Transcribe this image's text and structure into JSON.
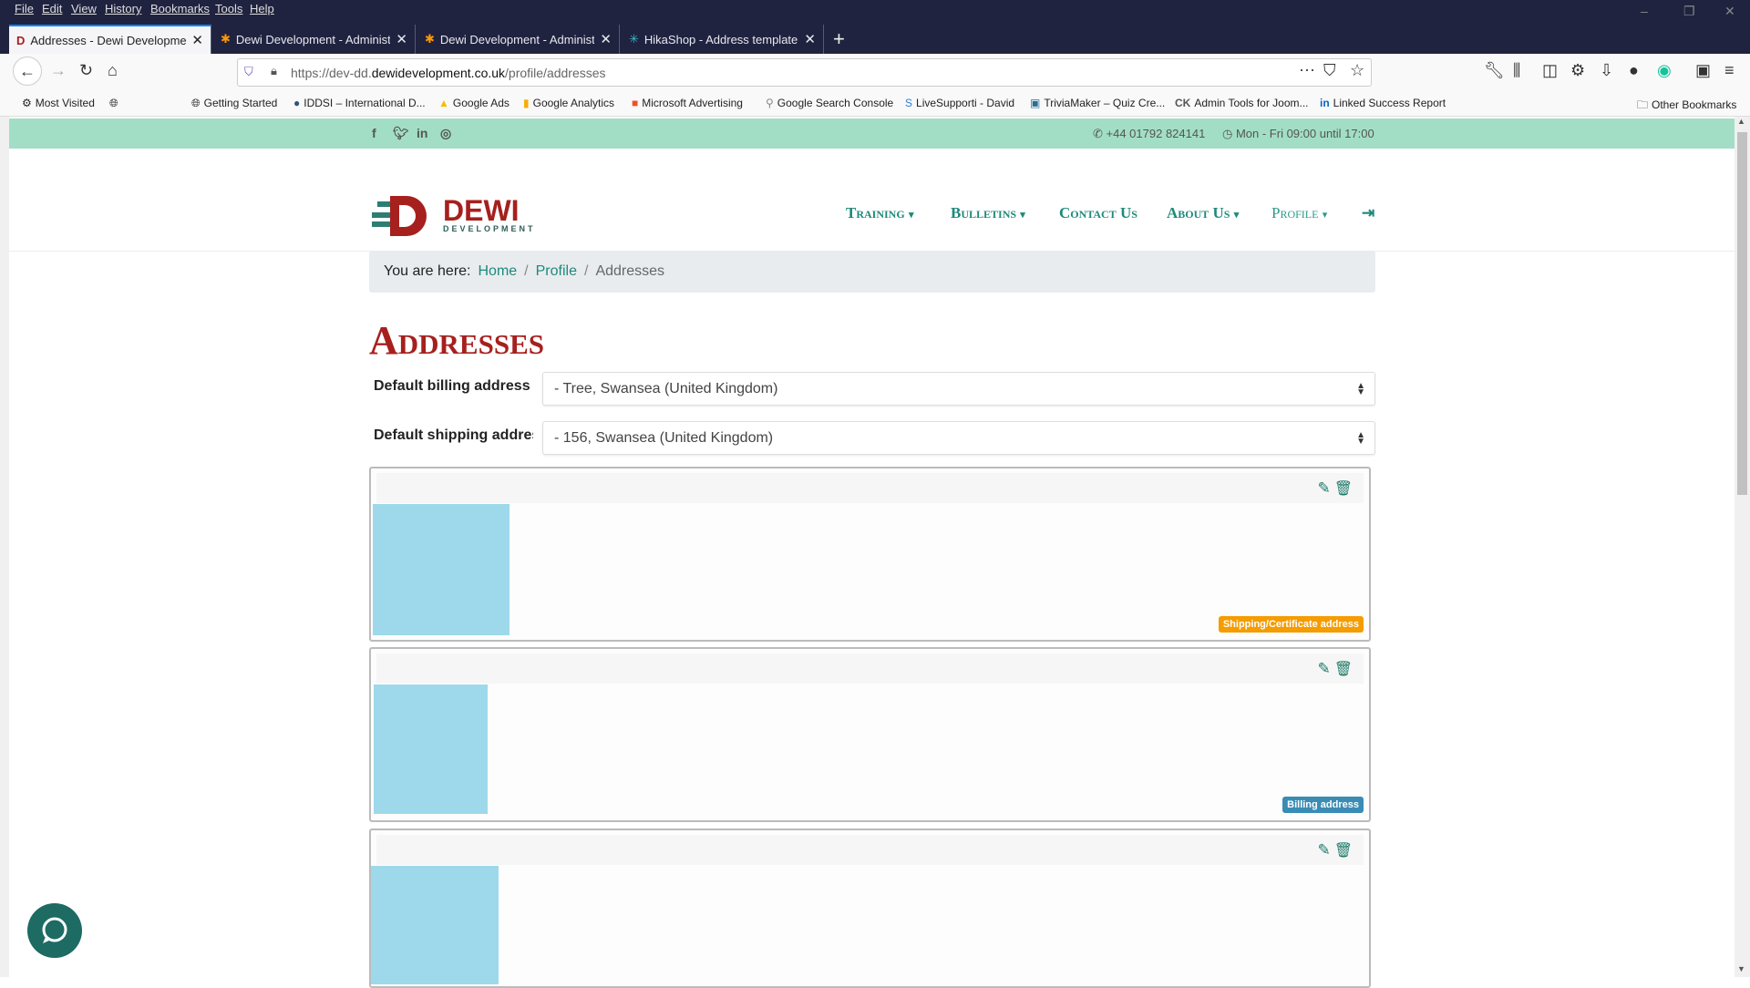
{
  "browser": {
    "menu": [
      "File",
      "Edit",
      "View",
      "History",
      "Bookmarks",
      "Tools",
      "Help"
    ],
    "tabs": [
      {
        "label": "Addresses - Dewi Development"
      },
      {
        "label": "Dewi Development - Administr"
      },
      {
        "label": "Dewi Development - Administr"
      },
      {
        "label": "HikaShop - Address template S"
      }
    ],
    "url_prefix": "https://dev-dd.",
    "url_domain": "dewidevelopment.co.uk",
    "url_path": "/profile/addresses",
    "bookmarks": [
      "Most Visited",
      "Getting Started",
      "IDDSI – International D...",
      "Google Ads",
      "Google Analytics",
      "Microsoft Advertising",
      "Google Search Console",
      "LiveSupporti - David",
      "TriviaMaker – Quiz Cre...",
      "Admin Tools for Joom...",
      "Linked Success Report"
    ],
    "other_bookmarks": "Other Bookmarks"
  },
  "topbar": {
    "phone": "+44 01792 824141",
    "hours": "Mon - Fri 09:00 until 17:00"
  },
  "logo": {
    "name": "DEWI",
    "sub": "DEVELOPMENT"
  },
  "nav": [
    "Training",
    "Bulletins",
    "Contact Us",
    "About Us",
    "Profile"
  ],
  "breadcrumb": {
    "prefix": "You are here:",
    "items": [
      "Home",
      "Profile"
    ],
    "current": "Addresses"
  },
  "page": {
    "title": "Addresses",
    "billing_label": "Default billing address",
    "billing_value": "- Tree, Swansea (United Kingdom)",
    "shipping_label": "Default shipping address",
    "shipping_value": "- 156, Swansea (United Kingdom)"
  },
  "cards": [
    {
      "badge": "Shipping/Certificate address",
      "badge_color": "#f59c00"
    },
    {
      "badge": "Billing address",
      "badge_color": "#3a8cb5"
    },
    {}
  ]
}
